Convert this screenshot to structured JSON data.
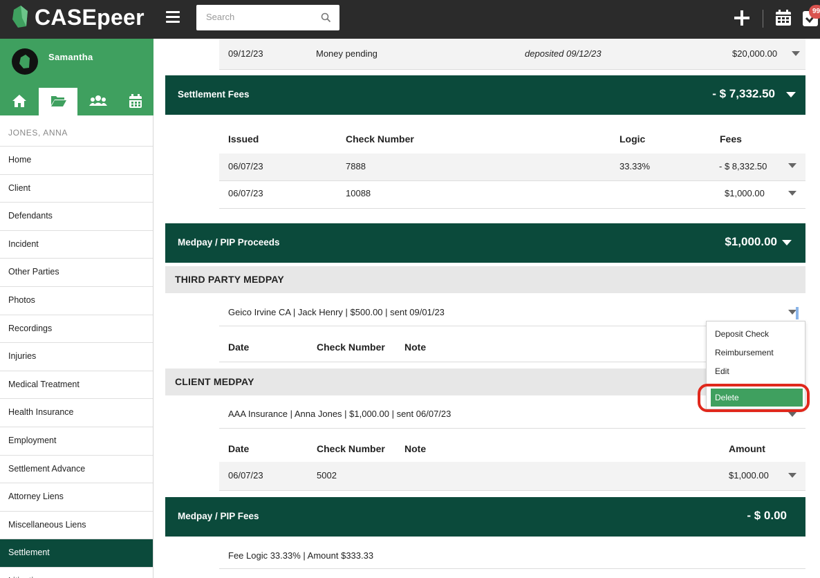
{
  "app": {
    "logo_text": "CASEpeer"
  },
  "search": {
    "placeholder": "Search"
  },
  "header": {
    "badge_count": "99"
  },
  "user": {
    "name": "Samantha"
  },
  "case": {
    "name": "JONES, ANNA"
  },
  "sidebar": {
    "items": [
      {
        "label": "Home"
      },
      {
        "label": "Client"
      },
      {
        "label": "Defendants"
      },
      {
        "label": "Incident"
      },
      {
        "label": "Other Parties"
      },
      {
        "label": "Photos"
      },
      {
        "label": "Recordings"
      },
      {
        "label": "Injuries"
      },
      {
        "label": "Medical Treatment"
      },
      {
        "label": "Health Insurance"
      },
      {
        "label": "Employment"
      },
      {
        "label": "Settlement Advance"
      },
      {
        "label": "Attorney Liens"
      },
      {
        "label": "Miscellaneous Liens"
      },
      {
        "label": "Settlement"
      },
      {
        "label": "Litigation"
      }
    ]
  },
  "top_row": {
    "date": "09/12/23",
    "status": "Money pending",
    "note": "deposited 09/12/23",
    "amount": "$20,000.00"
  },
  "settlement_fees": {
    "title": "Settlement Fees",
    "amount": "- $ 7,332.50",
    "headers": {
      "issued": "Issued",
      "check": "Check Number",
      "logic": "Logic",
      "fees": "Fees"
    },
    "rows": [
      {
        "issued": "06/07/23",
        "check": "7888",
        "logic": "33.33%",
        "fees": "- $ 8,332.50"
      },
      {
        "issued": "06/07/23",
        "check": "10088",
        "logic": "",
        "fees": "$1,000.00"
      }
    ]
  },
  "medpay_proceeds": {
    "title": "Medpay / PIP Proceeds",
    "amount": "$1,000.00",
    "third_party": {
      "heading": "THIRD PARTY MEDPAY",
      "entry": "Geico Irvine CA | Jack Henry | $500.00 | sent 09/01/23",
      "headers": {
        "date": "Date",
        "check": "Check Number",
        "note": "Note"
      }
    },
    "client": {
      "heading": "CLIENT MEDPAY",
      "entry": "AAA Insurance | Anna Jones | $1,000.00 | sent 06/07/23",
      "headers": {
        "date": "Date",
        "check": "Check Number",
        "note": "Note",
        "amount": "Amount"
      },
      "rows": [
        {
          "date": "06/07/23",
          "check": "5002",
          "amount": "$1,000.00"
        }
      ]
    }
  },
  "dropdown": {
    "items": [
      {
        "label": "Deposit Check"
      },
      {
        "label": "Reimbursement"
      },
      {
        "label": "Edit"
      },
      {
        "label": "Delete"
      }
    ]
  },
  "medpay_fees": {
    "title": "Medpay / PIP Fees",
    "amount": "- $ 0.00",
    "detail": "Fee Logic 33.33% | Amount $333.33"
  }
}
